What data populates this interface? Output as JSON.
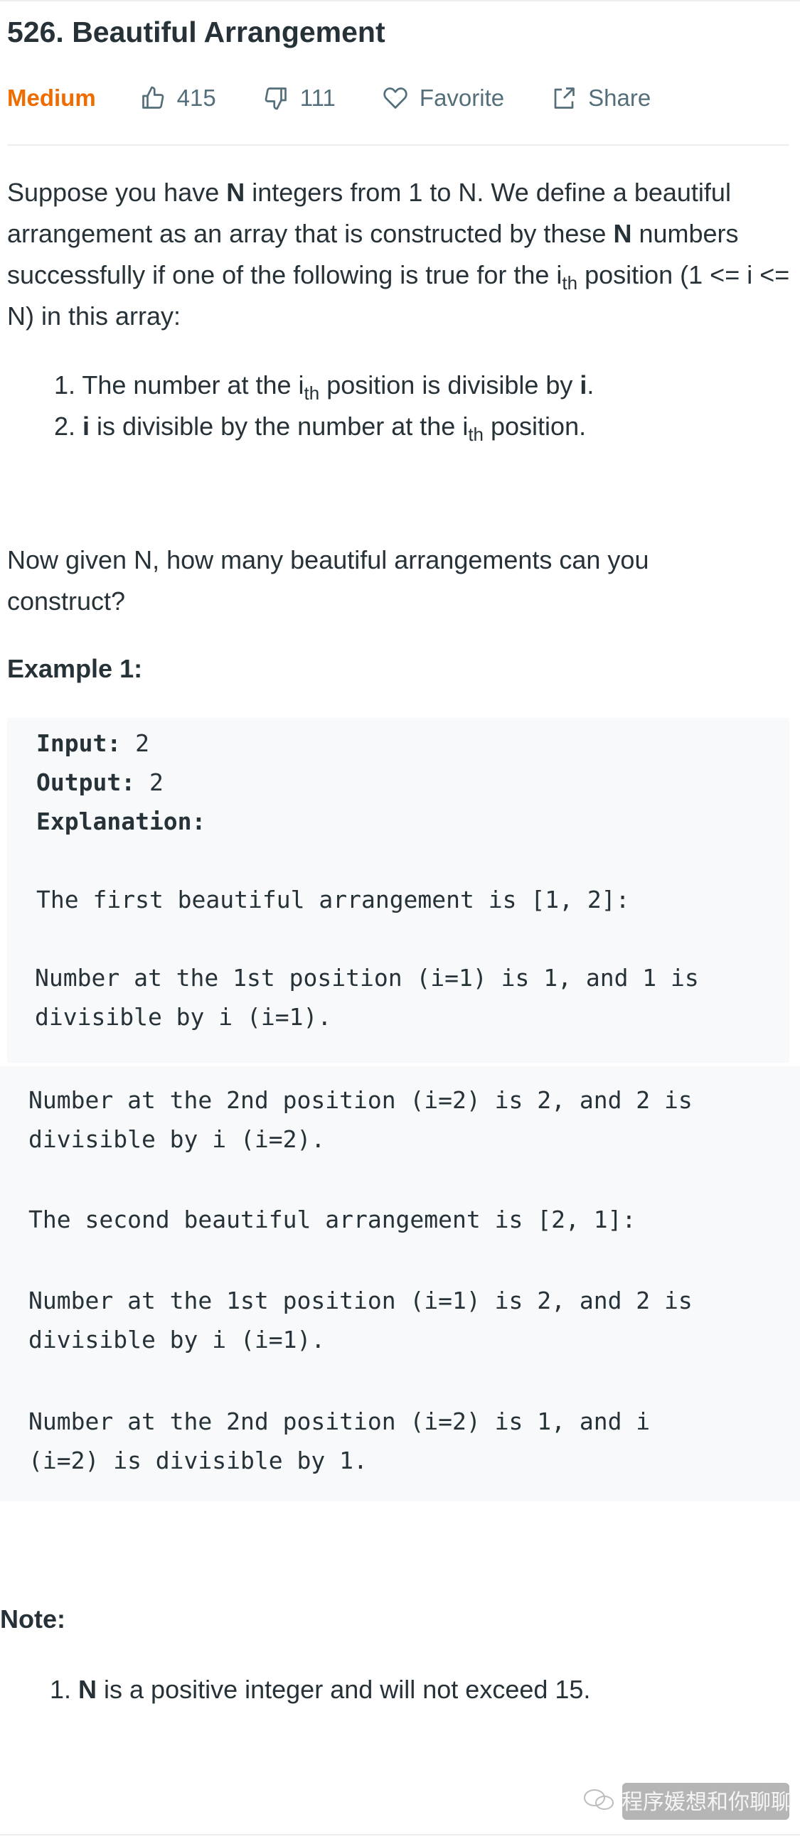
{
  "problem": {
    "title": "526. Beautiful Arrangement",
    "difficulty": "Medium",
    "likes": "415",
    "dislikes": "111",
    "favorite_label": "Favorite",
    "share_label": "Share"
  },
  "description": {
    "p1_a": "Suppose you have ",
    "p1_b": "N",
    "p1_c": " integers from 1 to N. We define a beautiful arrangement as an array that is constructed by these ",
    "p1_d": "N",
    "p1_e": " numbers successfully if one of the following is true for the i",
    "p1_f": "th",
    "p1_g": " position (1 <= i <= N) in this array:",
    "items": [
      {
        "a": "1. The number at the i",
        "b": "th",
        "c": " position is divisible by ",
        "d": "i",
        "e": "."
      },
      {
        "a": "2. ",
        "b": "i",
        "c": " is divisible by the number at the i",
        "d": "th",
        "e": " position."
      }
    ],
    "p2": "Now given N, how many beautiful arrangements can you construct?"
  },
  "example": {
    "heading": "Example 1:",
    "input_label": "Input:",
    "input_value": " 2",
    "output_label": "Output:",
    "output_value": " 2",
    "explanation_label": "Explanation:",
    "lines": [
      "The first beautiful arrangement is [1, 2]:",
      "Number at the 1st position (i=1) is 1, and 1 is",
      "divisible by i (i=1).",
      "Number at the 2nd position (i=2) is 2, and 2 is",
      "divisible by i (i=2).",
      "The second beautiful arrangement is [2, 1]:",
      "Number at the 1st position (i=1) is 2, and 2 is",
      "divisible by i (i=1).",
      "Number at the 2nd position (i=2) is 1, and i",
      "(i=2) is divisible by 1."
    ]
  },
  "note": {
    "heading": "Note:",
    "item_a": "1. ",
    "item_b": "N",
    "item_c": " is a positive integer and will not exceed 15."
  },
  "watermark": {
    "text": "程序媛想和你聊聊"
  },
  "colors": {
    "difficulty": "#ef6c00",
    "text": "#263238",
    "muted": "#546e7a",
    "code_bg": "#f7f9fa"
  }
}
